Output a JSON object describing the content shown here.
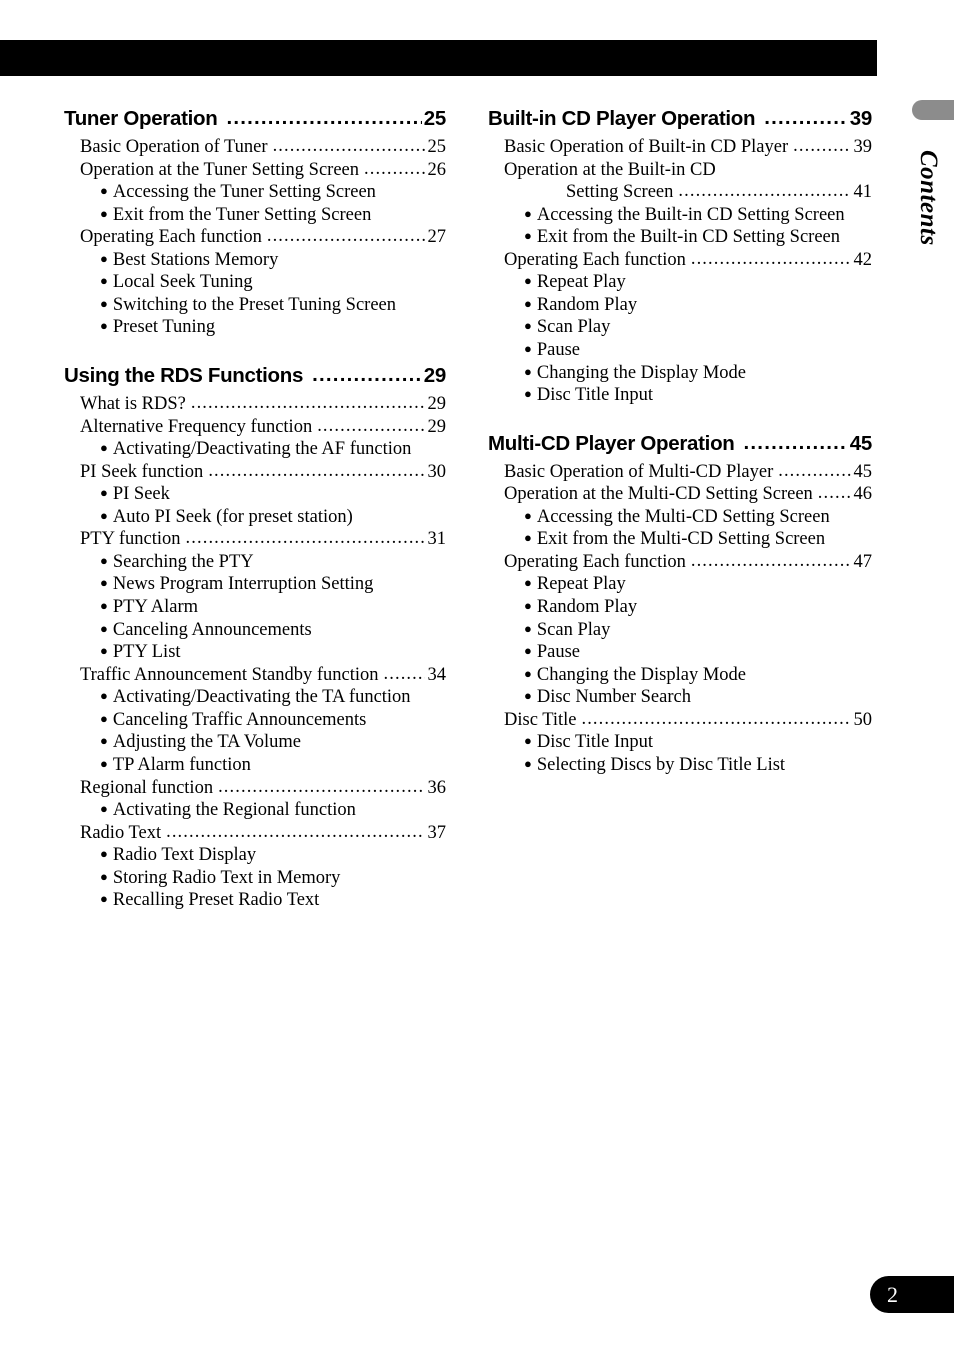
{
  "page": {
    "number": "2",
    "side_label": "Contents",
    "leader_char": "."
  },
  "columns": {
    "left": [
      {
        "heading": "Tuner Operation",
        "page": "25",
        "items": [
          {
            "type": "entry",
            "label": "Basic Operation of Tuner",
            "page": "25"
          },
          {
            "type": "entry",
            "label": "Operation at the Tuner Setting Screen",
            "page": "26"
          },
          {
            "type": "bullet",
            "label": "Accessing the Tuner Setting Screen"
          },
          {
            "type": "bullet",
            "label": "Exit from the Tuner Setting Screen"
          },
          {
            "type": "entry",
            "label": "Operating Each function",
            "page": "27"
          },
          {
            "type": "bullet",
            "label": "Best Stations Memory"
          },
          {
            "type": "bullet",
            "label": "Local Seek Tuning"
          },
          {
            "type": "bullet",
            "label": "Switching to the Preset Tuning Screen"
          },
          {
            "type": "bullet",
            "label": "Preset Tuning"
          }
        ]
      },
      {
        "heading": "Using the RDS Functions",
        "page": "29",
        "items": [
          {
            "type": "entry",
            "label": "What is RDS?",
            "page": "29"
          },
          {
            "type": "entry",
            "label": "Alternative Frequency function",
            "page": "29"
          },
          {
            "type": "bullet",
            "label": "Activating/Deactivating the AF function"
          },
          {
            "type": "entry",
            "label": "PI Seek function",
            "page": "30"
          },
          {
            "type": "bullet",
            "label": "PI Seek"
          },
          {
            "type": "bullet",
            "label": "Auto PI Seek (for preset station)"
          },
          {
            "type": "entry",
            "label": "PTY function",
            "page": "31"
          },
          {
            "type": "bullet",
            "label": "Searching the PTY"
          },
          {
            "type": "bullet",
            "label": "News Program Interruption Setting"
          },
          {
            "type": "bullet",
            "label": "PTY Alarm"
          },
          {
            "type": "bullet",
            "label": "Canceling Announcements"
          },
          {
            "type": "bullet",
            "label": "PTY List"
          },
          {
            "type": "entry",
            "label": "Traffic Announcement Standby function",
            "page": "34"
          },
          {
            "type": "bullet",
            "label": "Activating/Deactivating the TA function"
          },
          {
            "type": "bullet",
            "label": "Canceling Traffic Announcements"
          },
          {
            "type": "bullet",
            "label": "Adjusting the TA Volume"
          },
          {
            "type": "bullet",
            "label": "TP Alarm function"
          },
          {
            "type": "entry",
            "label": "Regional function",
            "page": "36"
          },
          {
            "type": "bullet",
            "label": "Activating the Regional function"
          },
          {
            "type": "entry",
            "label": "Radio Text",
            "page": "37"
          },
          {
            "type": "bullet",
            "label": "Radio Text Display"
          },
          {
            "type": "bullet",
            "label": "Storing Radio Text in Memory"
          },
          {
            "type": "bullet",
            "label": "Recalling Preset Radio Text"
          }
        ]
      }
    ],
    "right": [
      {
        "heading": "Built-in CD Player Operation",
        "page": "39",
        "items": [
          {
            "type": "entry",
            "label": "Basic Operation of Built-in CD Player",
            "page": "39"
          },
          {
            "type": "entry-nopage",
            "label": "Operation at the Built-in CD"
          },
          {
            "type": "entry-cont",
            "label": "Setting Screen",
            "page": "41"
          },
          {
            "type": "bullet",
            "label": "Accessing the Built-in CD Setting Screen"
          },
          {
            "type": "bullet",
            "label": "Exit from the Built-in CD Setting Screen"
          },
          {
            "type": "entry",
            "label": "Operating Each function",
            "page": "42"
          },
          {
            "type": "bullet",
            "label": "Repeat Play"
          },
          {
            "type": "bullet",
            "label": "Random Play"
          },
          {
            "type": "bullet",
            "label": "Scan Play"
          },
          {
            "type": "bullet",
            "label": "Pause"
          },
          {
            "type": "bullet",
            "label": "Changing the Display Mode"
          },
          {
            "type": "bullet",
            "label": "Disc Title Input"
          }
        ]
      },
      {
        "heading": "Multi-CD Player Operation",
        "page": "45",
        "items": [
          {
            "type": "entry",
            "label": "Basic Operation of Multi-CD Player",
            "page": "45"
          },
          {
            "type": "entry",
            "label": "Operation at the Multi-CD Setting Screen",
            "page": "46"
          },
          {
            "type": "bullet",
            "label": "Accessing the Multi-CD Setting Screen"
          },
          {
            "type": "bullet",
            "label": "Exit from the Multi-CD Setting Screen"
          },
          {
            "type": "entry",
            "label": "Operating Each function",
            "page": "47"
          },
          {
            "type": "bullet",
            "label": "Repeat Play"
          },
          {
            "type": "bullet",
            "label": "Random Play"
          },
          {
            "type": "bullet",
            "label": "Scan Play"
          },
          {
            "type": "bullet",
            "label": "Pause"
          },
          {
            "type": "bullet",
            "label": "Changing the Display Mode"
          },
          {
            "type": "bullet",
            "label": "Disc Number Search"
          },
          {
            "type": "entry",
            "label": "Disc Title",
            "page": "50"
          },
          {
            "type": "bullet",
            "label": "Disc Title Input"
          },
          {
            "type": "bullet",
            "label": "Selecting Discs by Disc Title List"
          }
        ]
      }
    ]
  }
}
